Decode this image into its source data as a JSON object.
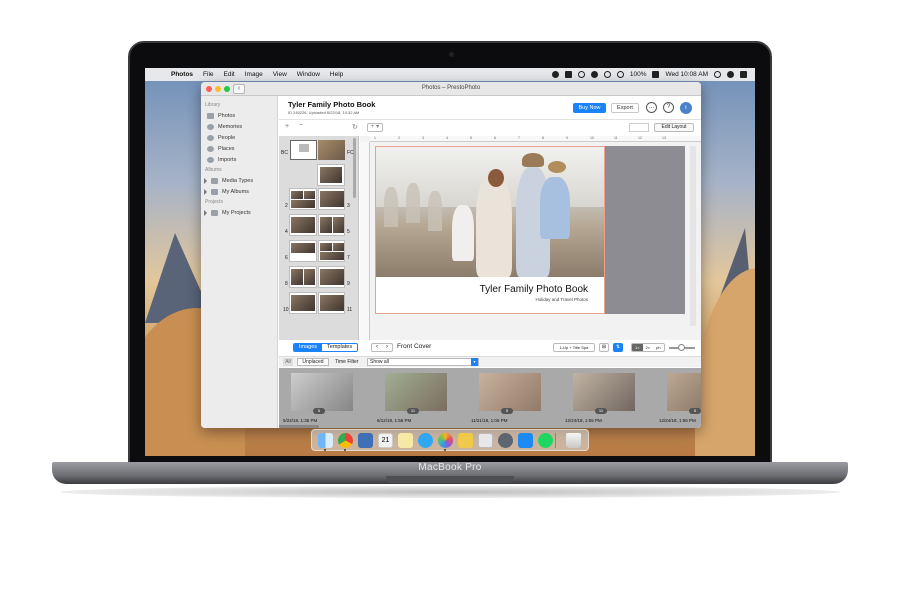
{
  "device": {
    "brand_label": "MacBook Pro"
  },
  "menubar": {
    "app_name": "Photos",
    "items": [
      "File",
      "Edit",
      "Image",
      "View",
      "Window",
      "Help"
    ],
    "battery": "100%",
    "clock": "Wed 10:08 AM"
  },
  "window": {
    "title": "Photos – PrestoPhoto"
  },
  "sidebar": {
    "library_label": "Library",
    "library_items": [
      "Photos",
      "Memories",
      "People",
      "Places",
      "Imports"
    ],
    "albums_label": "Albums",
    "album_items": [
      "Media Types",
      "My Albums"
    ],
    "projects_label": "Projects",
    "project_items": [
      "My Projects"
    ]
  },
  "header": {
    "title": "Tyler Family Photo Book",
    "subtitle": "ID 245226, Uploaded 6/22/18, 10:32 AM",
    "buy_label": "Buy Now",
    "export_label": "Export",
    "avatar_initial": "t"
  },
  "toolbar": {
    "add_label": "+ ▾",
    "edit_layout_label": "Edit Layout"
  },
  "pages_panel": {
    "cover_left": "BC",
    "cover_right": "FC",
    "page_numbers": [
      "2",
      "3",
      "4",
      "5",
      "6",
      "7",
      "8",
      "9",
      "10",
      "11"
    ]
  },
  "ruler": {
    "numbers": [
      "1",
      "2",
      "3",
      "4",
      "5",
      "6",
      "7",
      "8",
      "9",
      "10",
      "11",
      "12",
      "13"
    ]
  },
  "cover": {
    "title": "Tyler Family Photo Book",
    "subtitle": "Holiday and Travel Photos"
  },
  "nav": {
    "tab_images": "Images",
    "tab_templates": "Templates",
    "current_page": "Front Cover",
    "layout_select": "1-Up + Title Spa",
    "zoom_options": [
      "1×",
      "2×",
      "ph"
    ]
  },
  "filter": {
    "all_label": "All",
    "unplaced_label": "Unplaced",
    "time_filter_label": "Time Filter",
    "time_filter_value": "Show all"
  },
  "strip": {
    "items": [
      {
        "badge": "5",
        "date": "5/22/18, 1:35 PM"
      },
      {
        "badge": "11",
        "date": "6/12/18, 1:55 PM"
      },
      {
        "badge": "5",
        "date": "11/21/18, 1:05 PM"
      },
      {
        "badge": "11",
        "date": "12/24/18, 1:55 PM"
      },
      {
        "badge": "5",
        "date": "12/24/18, 1:55 PM"
      }
    ]
  },
  "colors": {
    "accent": "#1a82fb",
    "selection_border": "#e9a28d",
    "back_cover_panel": "#8c8c92"
  }
}
